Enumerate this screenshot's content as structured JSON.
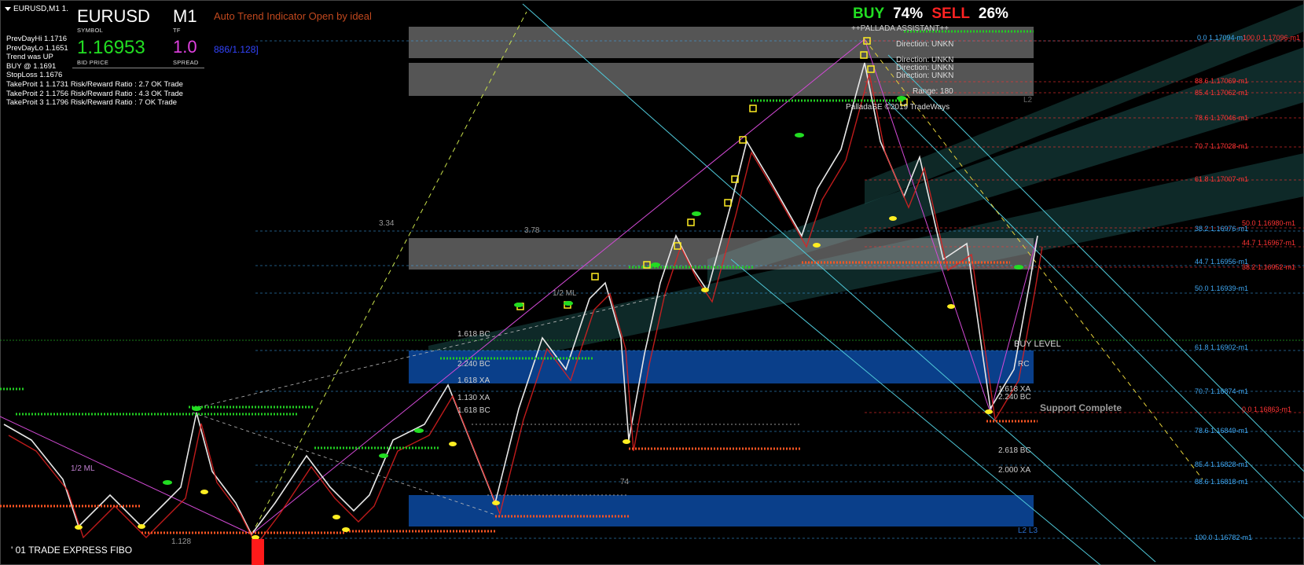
{
  "window": {
    "title": "EURUSD,M1  1."
  },
  "info_panel": {
    "lines": [
      "PrevDayHi 1.1716",
      "PrevDayLo 1.1651",
      "Trend was UP",
      "BUY @ 1.1691",
      "StopLoss 1.1676",
      "TakeProit 1 1.1731 Risk/Reward Ratio : 2.7 OK Trade",
      "TakeProit 2 1.1756 Risk/Reward Ratio : 4.3 OK Trade",
      "TakeProit 3 1.1796 Risk/Reward Ratio : 7 OK Trade"
    ]
  },
  "symbol_box": {
    "symbol": "EURUSD",
    "symbol_caption": "SYMBOL",
    "timeframe": "M1",
    "timeframe_caption": "TF",
    "bid": "1.16953",
    "bid_caption": "BID PRICE",
    "spread": "1.0",
    "spread_caption": "SPREAD"
  },
  "indicator_title": "Auto Trend Indicator Open by ideal",
  "ratio_text": "886/1.128]",
  "signal": {
    "buy_label": "BUY",
    "buy_pct": "74%",
    "sell_label": "SELL",
    "sell_pct": "26%",
    "buy_color": "#22dd22",
    "sell_color": "#ff2222"
  },
  "pallada": {
    "header": "++PALLADA ASSISTANT++",
    "directions": [
      "Direction: UNKN",
      "Direction: UNKN",
      "Direction: UNKN",
      "Direction: UNKN"
    ],
    "range": "Range: 180",
    "copyright": "PalladaSE ©2019 TradeWays"
  },
  "fib_right_labels": [
    {
      "text": "0.0   1.17094-m1",
      "color": "#3fa9f5"
    },
    {
      "text": "100.0   1.17096-m1",
      "color": "#ff3333"
    },
    {
      "text": "88.6   1.17069-m1",
      "color": "#ff3333"
    },
    {
      "text": "85.4   1.17062-m1",
      "color": "#ff3333"
    },
    {
      "text": "78.6   1.17046-m1",
      "color": "#ff3333"
    },
    {
      "text": "70.7   1.17028-m1",
      "color": "#ff3333"
    },
    {
      "text": "61.8   1.17007-m1",
      "color": "#ff3333"
    },
    {
      "text": "50.0   1.16980-m1",
      "color": "#ff3333"
    },
    {
      "text": "38.2   1.16976-m1",
      "color": "#3fa9f5"
    },
    {
      "text": "44.7   1.16967-m1",
      "color": "#ff3333"
    },
    {
      "text": "44.7   1.16956-m1",
      "color": "#3fa9f5"
    },
    {
      "text": "38.2   1.16952-m1",
      "color": "#ff3333"
    },
    {
      "text": "50.0   1.16939-m1",
      "color": "#3fa9f5"
    },
    {
      "text": "61.8   1.16902-m1",
      "color": "#3fa9f5"
    },
    {
      "text": "70.7   1.16874-m1",
      "color": "#3fa9f5"
    },
    {
      "text": "0.0   1.16863-m1",
      "color": "#ff3333"
    },
    {
      "text": "78.6   1.16849-m1",
      "color": "#3fa9f5"
    },
    {
      "text": "85.4   1.16828-m1",
      "color": "#3fa9f5"
    },
    {
      "text": "88.6   1.16818-m1",
      "color": "#3fa9f5"
    },
    {
      "text": "100.0   1.16782-m1",
      "color": "#3fa9f5"
    }
  ],
  "annotations": {
    "ml_left": "1/2 ML",
    "ml_mid": "1/2 ML",
    "val_334": "3.34",
    "val_378": "3.78",
    "val_1128": "1.128",
    "val_74": "74",
    "bc_1618_a": "1.618 BC",
    "bc_2240_a": "2.240 BC",
    "xa_1618_a": "1.618 XA",
    "xa_1130_a": "1.130 XA",
    "bc_1618_b": "1.618 BC",
    "bc_2618": "2.618 BC",
    "xa_2000": "2.000 XA",
    "xa_1618_b": "1.618 XA",
    "bc_2240_b": "2.240 BC",
    "bc_rc": "RC",
    "buy_level": "BUY LEVEL",
    "support_complete": "Support Complete",
    "l2_top": "L2",
    "l2l3": "L2 L3"
  },
  "bottom_note": "' 01 TRADE EXPRESS FIBO"
}
